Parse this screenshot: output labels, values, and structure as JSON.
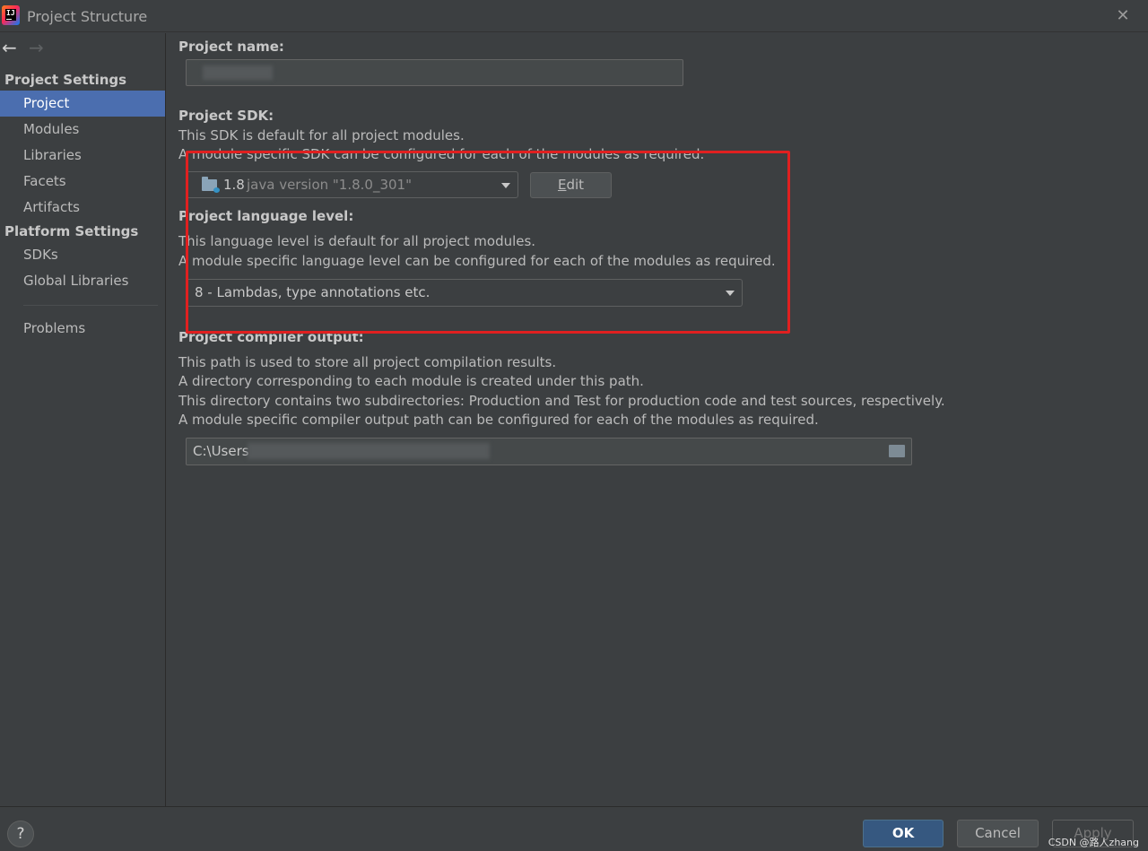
{
  "window": {
    "title": "Project Structure",
    "close_icon": "close-icon"
  },
  "sidebar": {
    "back_icon": "←",
    "forward_icon": "→",
    "project_settings_header": "Project Settings",
    "project_items": [
      "Project",
      "Modules",
      "Libraries",
      "Facets",
      "Artifacts"
    ],
    "platform_settings_header": "Platform Settings",
    "platform_items": [
      "SDKs",
      "Global Libraries"
    ],
    "problems": "Problems",
    "selected": "Project"
  },
  "main": {
    "project_name": {
      "label": "Project name:",
      "value": ""
    },
    "sdk": {
      "label": "Project SDK:",
      "desc1": "This SDK is default for all project modules.",
      "desc2": "A module specific SDK can be configured for each of the modules as required.",
      "selected_version": "1.8",
      "selected_detail": "java version \"1.8.0_301\"",
      "edit_button": "Edit",
      "edit_mnemonic": "E",
      "edit_rest": "dit"
    },
    "language_level": {
      "label": "Project language level:",
      "desc1": "This language level is default for all project modules.",
      "desc2": "A module specific language level can be configured for each of the modules as required.",
      "selected": "8 - Lambdas, type annotations etc."
    },
    "compiler_output": {
      "label": "Project compiler output:",
      "desc1": "This path is used to store all project compilation results.",
      "desc2": "A directory corresponding to each module is created under this path.",
      "desc3": "This directory contains two subdirectories: Production and Test for production code and test sources, respectively.",
      "desc4": "A module specific compiler output path can be configured for each of the modules as required.",
      "path_value": "C:\\Users"
    }
  },
  "footer": {
    "help": "?",
    "ok": "OK",
    "cancel": "Cancel",
    "apply": "Apply",
    "watermark": "CSDN @路人zhang"
  },
  "colors": {
    "background": "#3c3f41",
    "selection": "#4b6eaf",
    "primary_button": "#365880",
    "highlight_box": "#e02020"
  }
}
